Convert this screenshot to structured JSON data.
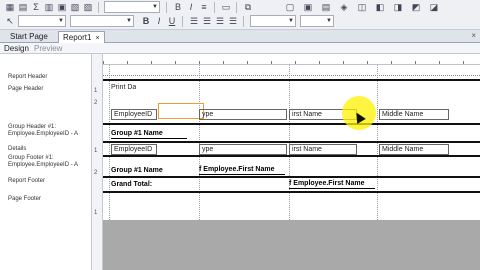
{
  "toolbar": {
    "icons_row1": [
      "new-report-icon",
      "open-icon",
      "sigma-icon",
      "grid-icon",
      "image-icon",
      "chart-icon",
      "calendar-icon",
      "pages-icon"
    ],
    "icons_row2": [
      "bold-icon",
      "italic-icon",
      "underline-icon",
      "align-left-icon",
      "align-center-icon",
      "align-right-icon",
      "align-justify-icon"
    ],
    "right_icons": [
      "layout-icon",
      "copy-icon",
      "paste-icon",
      "align-objects-icon",
      "size-icon",
      "spacing-icon"
    ]
  },
  "tabs": [
    {
      "label": "Start Page"
    },
    {
      "label": "Report1",
      "close": "×"
    }
  ],
  "tab_close_all": "×",
  "subtabs": {
    "design": "Design",
    "preview": "Preview"
  },
  "sections": [
    {
      "label": "Report Header"
    },
    {
      "label": "Page Header"
    },
    {
      "label": "Group Header #1: Employee.EmployeeID - A"
    },
    {
      "label": "Details"
    },
    {
      "label": "Group Footer #1: Employee.EmployeeID - A"
    },
    {
      "label": "Report Footer"
    },
    {
      "label": "Page Footer"
    }
  ],
  "ruler_marks": [
    "1",
    "2",
    "1",
    "2",
    "1"
  ],
  "fields": {
    "print_date": "Print Da",
    "ph_employee_id": "EmployeeID",
    "ph_type": "ype",
    "ph_first_name": "irst Name",
    "ph_middle_name": "Middle Name",
    "gh_group_name": "Group #1 Name",
    "d_employee_id": "EmployeeID",
    "d_type": "ype",
    "d_first_name": "irst Name",
    "d_middle_name": "Middle Name",
    "gf_group_name": "Group #1 Name",
    "gf_first_name": "f Employee.First Name",
    "rf_grand_total": "Grand Total:",
    "rf_first_name": "f Employee.First Name"
  }
}
